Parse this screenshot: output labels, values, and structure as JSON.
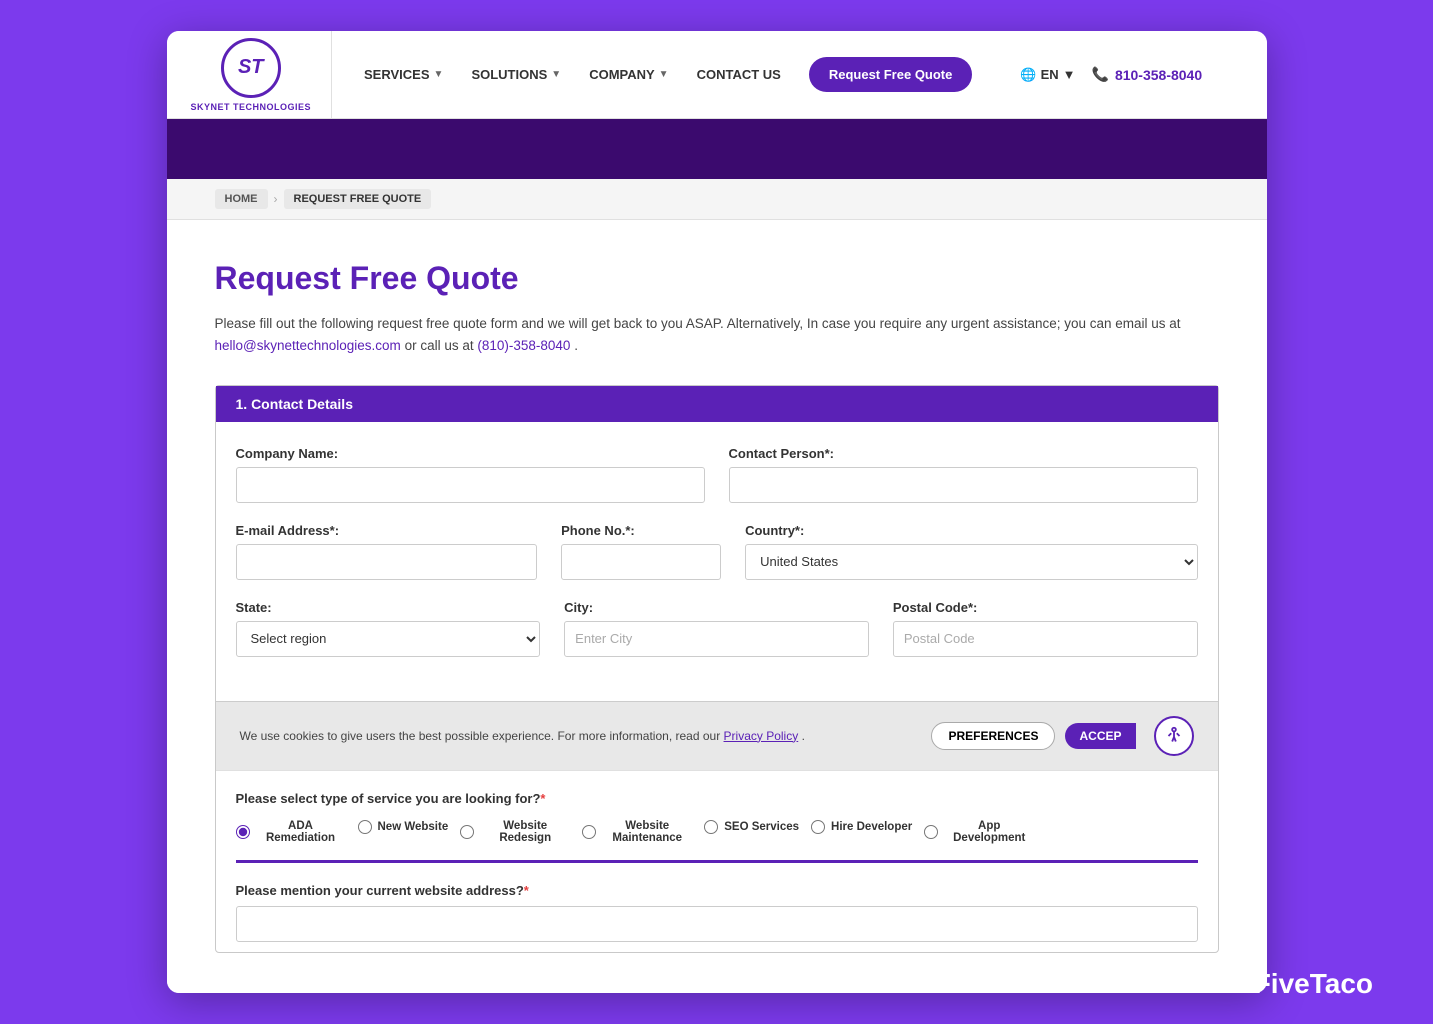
{
  "brand": {
    "logo_initials": "ST",
    "name": "SKYNET TECHNOLOGIES"
  },
  "nav": {
    "links": [
      {
        "label": "SERVICES",
        "has_arrow": true
      },
      {
        "label": "SOLUTIONS",
        "has_arrow": true
      },
      {
        "label": "COMPANY",
        "has_arrow": true
      },
      {
        "label": "CONTACT US",
        "has_arrow": false
      }
    ],
    "cta_label": "Request Free Quote",
    "lang_label": "EN",
    "phone": "810-358-8040"
  },
  "breadcrumb": {
    "home": "HOME",
    "current": "REQUEST FREE QUOTE"
  },
  "page": {
    "title": "Request Free Quote",
    "description_part1": "Please fill out the following request free quote form and we will get back to you ASAP. Alternatively, In case you require any urgent assistance; you can email us at ",
    "email_link": "hello@skynettechnologies.com",
    "description_part2": " or call us at ",
    "phone_link": "(810)-358-8040",
    "description_part3": "."
  },
  "form": {
    "section_title": "1. Contact Details",
    "fields": {
      "company_name_label": "Company Name:",
      "contact_person_label": "Contact Person*:",
      "email_label": "E-mail Address*:",
      "phone_label": "Phone No.*:",
      "country_label": "Country*:",
      "country_value": "United States",
      "state_label": "State:",
      "state_placeholder": "Select region",
      "city_label": "City:",
      "city_placeholder": "Enter City",
      "postal_code_label": "Postal Code*:",
      "postal_code_placeholder": "Postal Code"
    }
  },
  "cookie": {
    "message": "We use cookies to give users the best possible experience. For more information, read our ",
    "link_text": "Privacy Policy",
    "message_end": ".",
    "preferences_label": "PREFERENCES",
    "accept_label": "ACCEP"
  },
  "services": {
    "label": "Please select type of service you are looking for?",
    "req": "*",
    "options": [
      {
        "label": "ADA Remediation",
        "checked": true
      },
      {
        "label": "New Website",
        "checked": false
      },
      {
        "label": "Website Redesign",
        "checked": false
      },
      {
        "label": "Website Maintenance",
        "checked": false
      },
      {
        "label": "SEO Services",
        "checked": false
      },
      {
        "label": "Hire Developer",
        "checked": false
      },
      {
        "label": "App Development",
        "checked": false
      }
    ]
  },
  "website_field": {
    "label": "Please mention your current website address?",
    "req": "*"
  },
  "fivetaco": "FiveTaco"
}
